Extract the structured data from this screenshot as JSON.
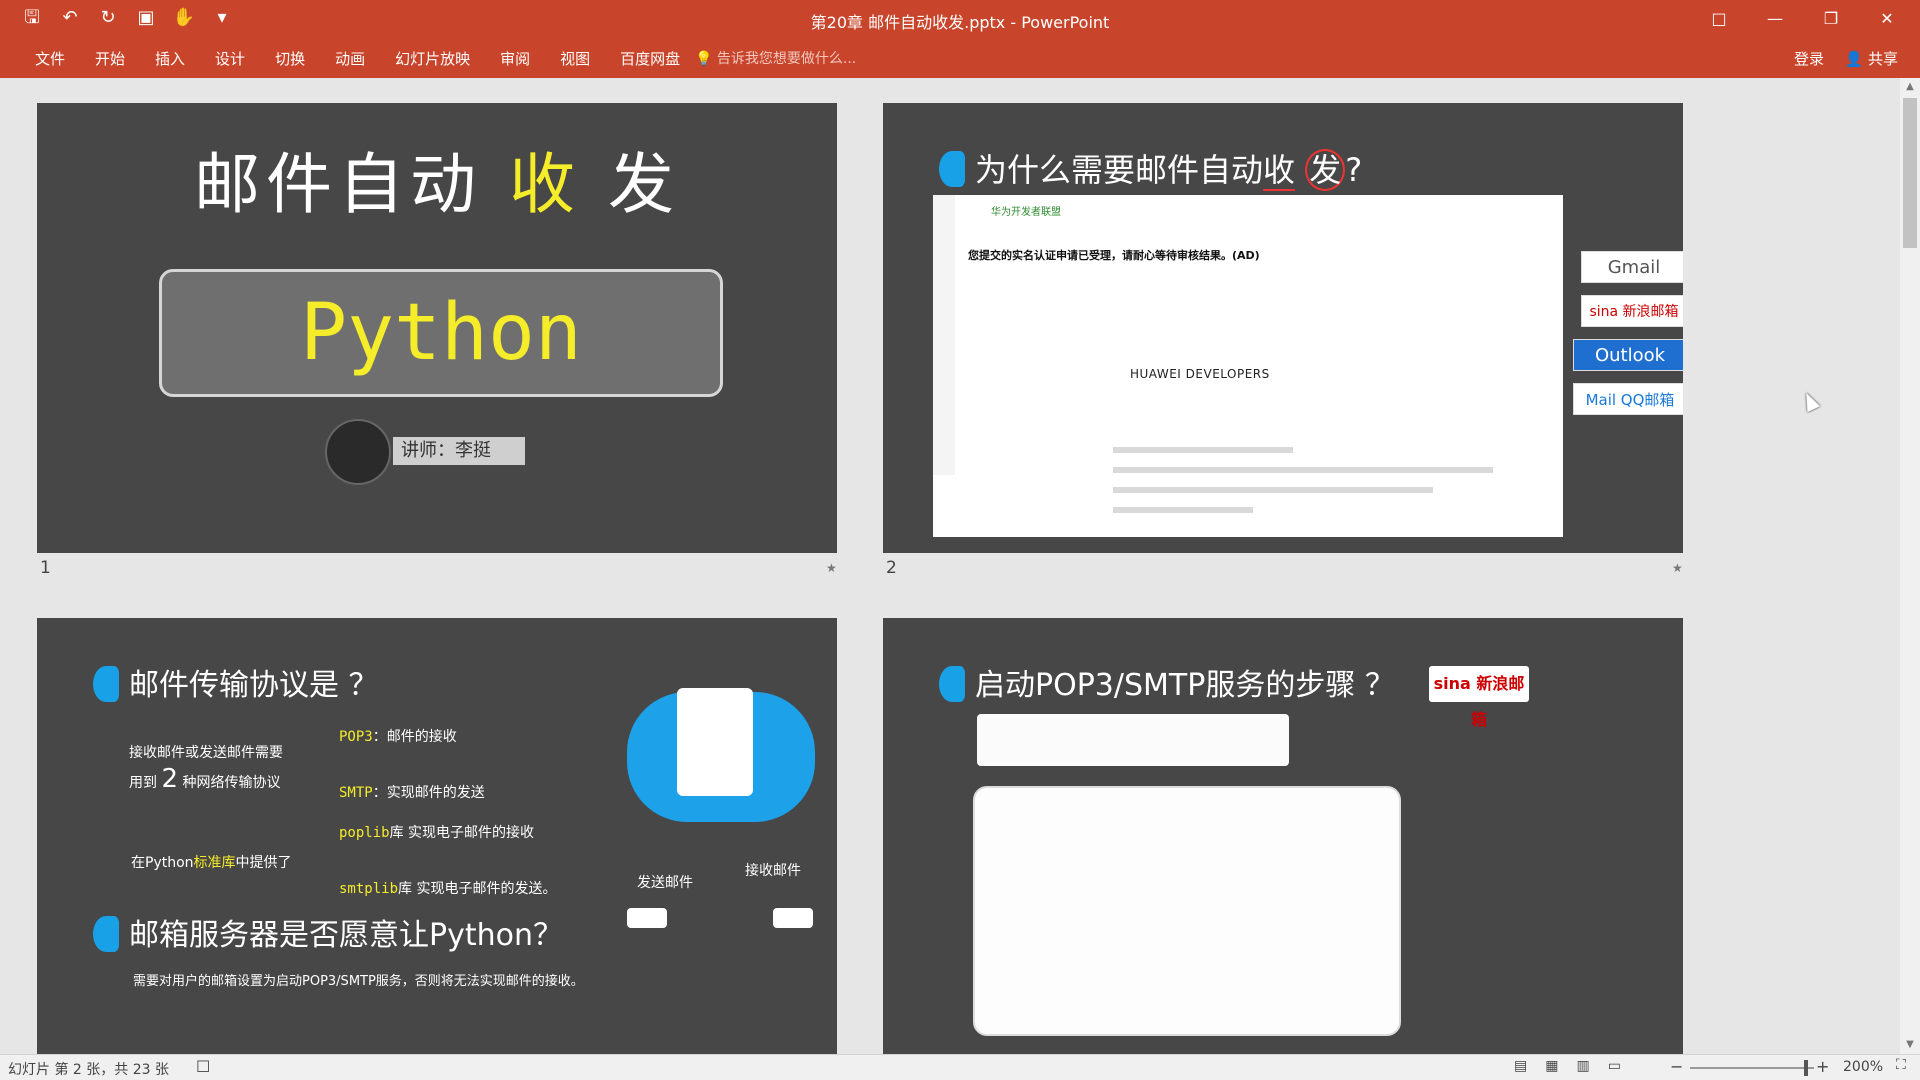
{
  "window": {
    "title": "第20章 邮件自动收发.pptx - PowerPoint",
    "qat": {
      "save_icon": "save-icon",
      "undo_icon": "undo-icon",
      "redo_icon": "redo-icon",
      "present_icon": "present-icon",
      "touch_icon": "touch-mode-icon",
      "more_icon": "customize-icon"
    }
  },
  "ribbon": {
    "tabs": [
      "文件",
      "开始",
      "插入",
      "设计",
      "切换",
      "动画",
      "幻灯片放映",
      "审阅",
      "视图",
      "百度网盘"
    ],
    "tellme": "告诉我您想要做什么...",
    "login": "登录",
    "share": "共享"
  },
  "slides": {
    "s1": {
      "num": "1",
      "title_a": "邮件自动",
      "title_b": "收",
      "title_c": "发",
      "python": "Python",
      "lecturer": "讲师：李挺"
    },
    "s2": {
      "num": "2",
      "title_a": "为什么需要邮件自动",
      "title_b": "收",
      "title_c": "发",
      "title_d": "?",
      "mail_from": "华为开发者联盟",
      "mail_subject": "您提交的实名认证申请已受理，请耐心等待审核结果。(AD)",
      "huawei": "HUAWEI DEVELOPERS",
      "brands": [
        "Gmail",
        "sina 新浪邮箱",
        "Outlook",
        "Mail QQ邮箱"
      ]
    },
    "s3": {
      "title": "邮件传输协议是 ？",
      "need_line1": "接收邮件或发送邮件需要",
      "need_line2_a": "用到",
      "need_num": "2",
      "need_line2_b": "种网络传输协议",
      "pop3_a": "POP3",
      "pop3_b": "：邮件的接收",
      "smtp_a": "SMTP",
      "smtp_b": "：实现邮件的发送",
      "python_std_a": "在Python",
      "python_std_b": "标准库",
      "python_std_c": "中提供了",
      "poplib_a": "poplib",
      "poplib_b": "库 实现电子邮件的接收",
      "smtplib_a": "smtplib",
      "smtplib_b": "库 实现电子邮件的发送。",
      "send_label": "发送邮件",
      "recv_label": "接收邮件",
      "title2": "邮箱服务器是否愿意让Python？",
      "note": "需要对用户的邮箱设置为启动POP3/SMTP服务，否则将无法实现邮件的接收。"
    },
    "s4": {
      "title": "启动POP3/SMTP服务的步骤 ？",
      "sina": "sina 新浪邮箱"
    }
  },
  "statusbar": {
    "slide_info": "幻灯片 第 2 张，共 23 张",
    "zoom": "200%"
  }
}
